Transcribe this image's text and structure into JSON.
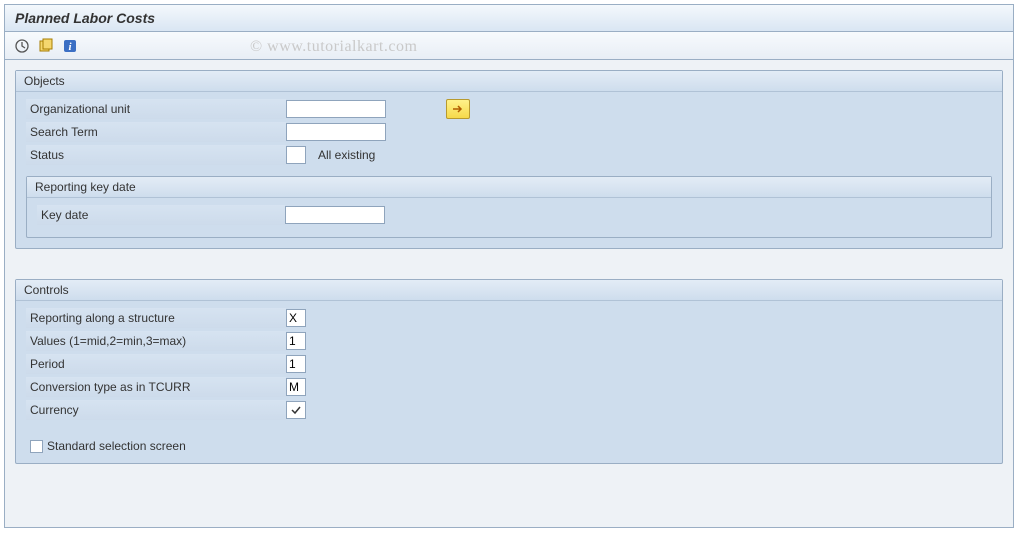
{
  "title": "Planned Labor Costs",
  "watermark": "© www.tutorialkart.com",
  "toolbar": {
    "icon1": "execute-icon",
    "icon2": "variant-icon",
    "icon3": "info-icon"
  },
  "groups": {
    "objects": {
      "header": "Objects",
      "org_unit_label": "Organizational unit",
      "org_unit_value": "",
      "search_term_label": "Search Term",
      "search_term_value": "",
      "status_label": "Status",
      "status_value": "",
      "status_text": "All existing",
      "reporting_header": "Reporting key date",
      "key_date_label": "Key date",
      "key_date_value": ""
    },
    "controls": {
      "header": "Controls",
      "reporting_structure_label": "Reporting along a structure",
      "reporting_structure_value": "X",
      "values_label": "Values (1=mid,2=min,3=max)",
      "values_value": "1",
      "period_label": "Period",
      "period_value": "1",
      "conversion_label": "Conversion type as in TCURR",
      "conversion_value": "M",
      "currency_label": "Currency",
      "currency_value": "✓",
      "std_selection_label": "Standard selection screen",
      "std_selection_checked": false
    }
  }
}
